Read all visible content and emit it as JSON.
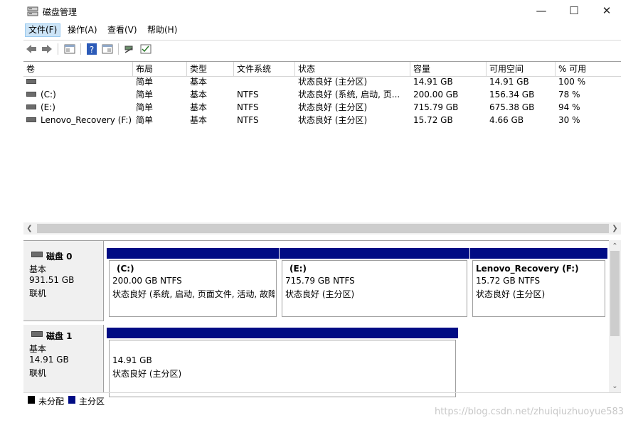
{
  "window": {
    "title": "磁盘管理",
    "minimize": "—",
    "maximize": "☐",
    "close": "✕"
  },
  "menu": [
    "文件(F)",
    "操作(A)",
    "查看(V)",
    "帮助(H)"
  ],
  "toolbar": [
    "back-icon",
    "forward-icon",
    "properties-icon",
    "help-icon",
    "view-icon",
    "connect-icon",
    "check-icon"
  ],
  "columns": [
    "卷",
    "布局",
    "类型",
    "文件系统",
    "状态",
    "容量",
    "可用空间",
    "% 可用"
  ],
  "volumes": [
    {
      "name": "",
      "layout": "简单",
      "type": "基本",
      "fs": "",
      "status": "状态良好 (主分区)",
      "capacity": "14.91 GB",
      "free": "14.91 GB",
      "pct": "100 %"
    },
    {
      "name": "(C:)",
      "layout": "简单",
      "type": "基本",
      "fs": "NTFS",
      "status": "状态良好 (系统, 启动, 页...",
      "capacity": "200.00 GB",
      "free": "156.34 GB",
      "pct": "78 %"
    },
    {
      "name": "(E:)",
      "layout": "简单",
      "type": "基本",
      "fs": "NTFS",
      "status": "状态良好 (主分区)",
      "capacity": "715.79 GB",
      "free": "675.38 GB",
      "pct": "94 %"
    },
    {
      "name": "Lenovo_Recovery (F:)",
      "layout": "简单",
      "type": "基本",
      "fs": "NTFS",
      "status": "状态良好 (主分区)",
      "capacity": "15.72 GB",
      "free": "4.66 GB",
      "pct": "30 %"
    }
  ],
  "disks": [
    {
      "name": "磁盘 0",
      "type": "基本",
      "size": "931.51 GB",
      "state": "联机",
      "partitions": [
        {
          "label": "(C:)",
          "size": "200.00 GB NTFS",
          "status": "状态良好 (系统, 启动, 页面文件, 活动, 故障"
        },
        {
          "label": "(E:)",
          "size": "715.79 GB NTFS",
          "status": "状态良好 (主分区)"
        },
        {
          "label": "Lenovo_Recovery  (F:)",
          "size": "15.72 GB NTFS",
          "status": "状态良好 (主分区)"
        }
      ]
    },
    {
      "name": "磁盘 1",
      "type": "基本",
      "size": "14.91 GB",
      "state": "联机",
      "partitions": [
        {
          "label": "",
          "size": "14.91 GB",
          "status": "状态良好 (主分区)"
        }
      ]
    }
  ],
  "legend": [
    {
      "label": "未分配",
      "color": "#000000"
    },
    {
      "label": "主分区",
      "color": "#000c84"
    }
  ],
  "watermark": "https://blog.csdn.net/zhuiqiuzhuoyue583"
}
